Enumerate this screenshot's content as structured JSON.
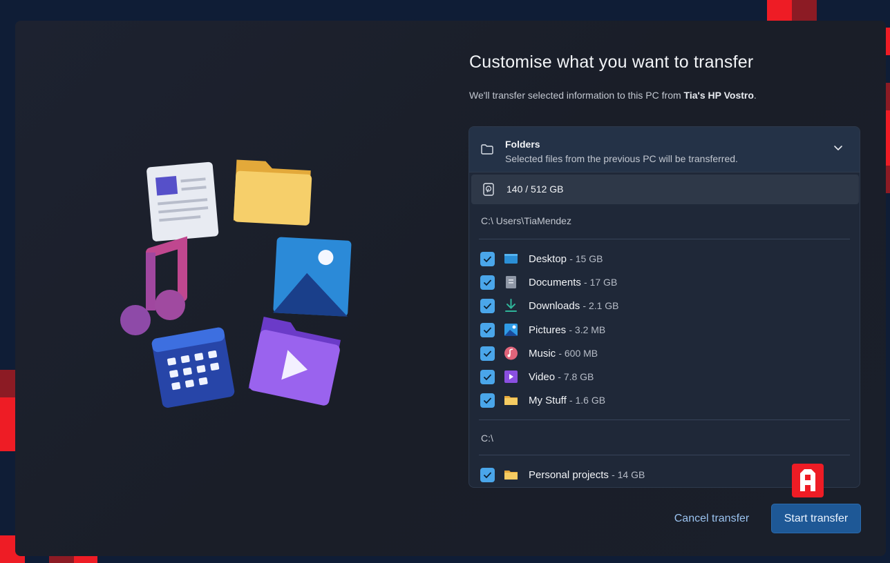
{
  "header": {
    "title": "Customise what you want to transfer",
    "subtitle_prefix": "We'll transfer selected information to this PC from ",
    "source_pc": "Tia's HP Vostro",
    "subtitle_suffix": "."
  },
  "panel": {
    "section_title": "Folders",
    "section_description": "Selected files from the previous PC will be transferred.",
    "storage": "140 / 512 GB",
    "groups": [
      {
        "path": "C:\\ Users\\TiaMendez",
        "items": [
          {
            "name": "Desktop",
            "size": "- 15 GB",
            "checked": true,
            "icon": "desktop-icon"
          },
          {
            "name": "Documents",
            "size": "- 17 GB",
            "checked": true,
            "icon": "documents-icon"
          },
          {
            "name": "Downloads",
            "size": "- 2.1 GB",
            "checked": true,
            "icon": "downloads-icon"
          },
          {
            "name": "Pictures",
            "size": "- 3.2 MB",
            "checked": true,
            "icon": "pictures-icon"
          },
          {
            "name": "Music",
            "size": "- 600 MB",
            "checked": true,
            "icon": "music-icon"
          },
          {
            "name": "Video",
            "size": "- 7.8 GB",
            "checked": true,
            "icon": "video-icon"
          },
          {
            "name": "My Stuff",
            "size": "- 1.6 GB",
            "checked": true,
            "icon": "folder-icon"
          }
        ]
      },
      {
        "path": "C:\\",
        "items": [
          {
            "name": "Personal projects",
            "size": "- 14 GB",
            "checked": true,
            "icon": "folder-icon"
          }
        ]
      }
    ]
  },
  "footer": {
    "cancel_label": "Cancel transfer",
    "start_label": "Start transfer"
  },
  "colors": {
    "accent": "#4aa6ea",
    "primary_button": "#1e5896",
    "brand_red": "#ee1c25"
  }
}
